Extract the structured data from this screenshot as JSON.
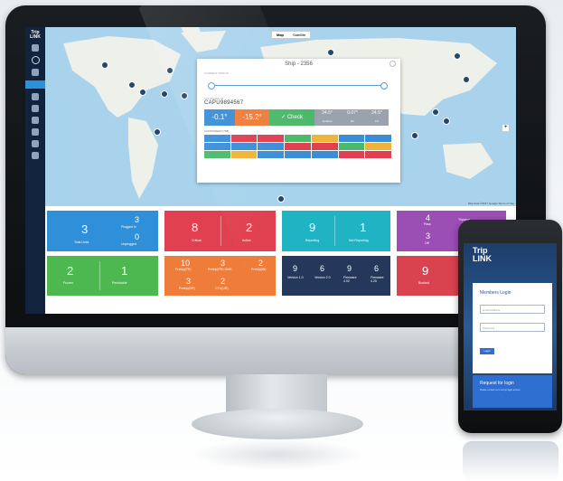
{
  "app": {
    "logo": "Trip\nLINK"
  },
  "map": {
    "toggle": [
      "Map",
      "Satellite"
    ],
    "footer": "Map data ©2017 Google  Terms of Use"
  },
  "popup": {
    "title": "Ship - 2356",
    "route_label": "CURRENT STATUS",
    "container_id_label": "CONTAINER ID",
    "container_id": "CAPU9894567",
    "sensors": [
      {
        "value": "-0.1°",
        "color": "#3b8ed6"
      },
      {
        "value": "-15.2°",
        "color": "#f07c3a"
      },
      {
        "value": "✓ Check",
        "color": "#4cb96a"
      },
      {
        "value": "24.5°",
        "sub": "Ambient",
        "color": "#9aa3ad"
      },
      {
        "value": "0.07°",
        "sub": "DC",
        "color": "#9aa3ad"
      },
      {
        "value": "24.5°",
        "sub": "CO",
        "color": "#9aa3ad"
      }
    ],
    "containers_label": "CONTAINERS (758)"
  },
  "tiles": {
    "units": {
      "big": "3",
      "label": "Total Units",
      "plugged": "3",
      "plugged_label": "Plugged In",
      "unplugged": "0",
      "unplugged_label": "Unplugged",
      "color": "#2f8fd8"
    },
    "alarms": {
      "critical": "8",
      "critical_label": "Critical",
      "active": "2",
      "active_label": "Active",
      "color": "#e0404f"
    },
    "reporting": {
      "reporting": "9",
      "reporting_label": "Reporting",
      "not_reporting": "1",
      "not_reporting_label": "Not Reporting",
      "color": "#1fb3c4"
    },
    "trips": {
      "v1": "4",
      "v1_label": "Pass",
      "v2": "3",
      "v2_label": "Off",
      "v3_label": "Tripwise",
      "color": "#9b4fb5"
    },
    "frozen": {
      "frozen": "2",
      "frozen_label": "Frozen",
      "perishable": "1",
      "perishable_label": "Perishable",
      "color": "#4cb84f"
    },
    "pretrip": {
      "a": "10",
      "a_label": "Pretrip(PR)",
      "b": "3",
      "b_label": "Pretrip(PR) OMS",
      "c": "2",
      "c_label": "Pretrip(MI)",
      "d": "3",
      "d_label": "Pretrip(DR)",
      "e": "2",
      "e_label": "CTU(UR)",
      "color": "#f07c3a"
    },
    "versions": {
      "v1": "9",
      "v1_label": "Version 1.0",
      "v2": "6",
      "v2_label": "Version 2.0",
      "v3": "9",
      "v3_label": "Firmware 4.92",
      "v4": "6",
      "v4_label": "Firmware 4.25",
      "color": "#25375a"
    },
    "booked": {
      "v": "9",
      "label": "Booked",
      "color": "#d9434f"
    }
  },
  "phone": {
    "logo": "Trip\nLINK",
    "login_title": "Members Login",
    "email_placeholder": "Email Address",
    "password_placeholder": "Password",
    "login_button": "Login",
    "request_title": "Request for login",
    "request_sub": "Please contact us to set up login access"
  }
}
